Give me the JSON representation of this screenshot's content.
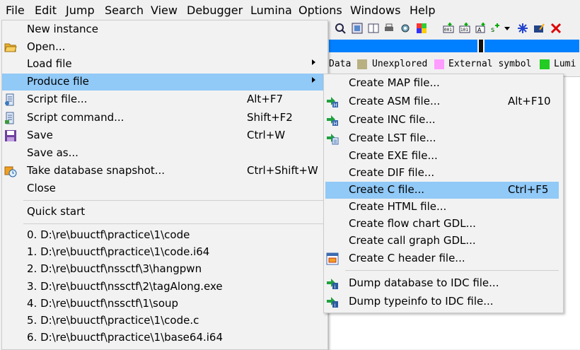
{
  "menubar": [
    "File",
    "Edit",
    "Jump",
    "Search",
    "View",
    "Debugger",
    "Lumina",
    "Options",
    "Windows",
    "Help"
  ],
  "legend": {
    "data": "Data",
    "unexplored": "Unexplored",
    "external": "External symbol",
    "lumina": "Lumi"
  },
  "colors": {
    "highlight": "#91c9f7",
    "nav_blue": "#0080ff",
    "unexplored": "#b8b080",
    "external": "#ff9cff",
    "lumina": "#22cc22"
  },
  "file_menu": {
    "new_instance": "New instance",
    "open": "Open...",
    "load_file": "Load file",
    "produce_file": "Produce file",
    "script_file": "Script file...",
    "script_file_sc": "Alt+F7",
    "script_command": "Script command...",
    "script_command_sc": "Shift+F2",
    "save": "Save",
    "save_sc": "Ctrl+W",
    "save_as": "Save as...",
    "snapshot": "Take database snapshot...",
    "snapshot_sc": "Ctrl+Shift+W",
    "close": "Close",
    "quick_start": "Quick start",
    "recent": [
      "0. D:\\re\\buuctf\\practice\\1\\code",
      "1. D:\\re\\buuctf\\practice\\1\\code.i64",
      "2. D:\\re\\buuctf\\nssctf\\3\\hangpwn",
      "3. D:\\re\\buuctf\\nssctf\\2\\tagAlong.exe",
      "4. D:\\re\\buuctf\\nssctf\\1\\soup",
      "5. D:\\re\\buuctf\\practice\\1\\code.c",
      "6. D:\\re\\buuctf\\practice\\1\\base64.i64"
    ]
  },
  "produce_menu": {
    "map": "Create MAP file...",
    "asm": "Create ASM file...",
    "asm_sc": "Alt+F10",
    "inc": "Create INC file...",
    "lst": "Create LST file...",
    "exe": "Create EXE file...",
    "dif": "Create DIF file...",
    "c": "Create C file...",
    "c_sc": "Ctrl+F5",
    "html": "Create HTML file...",
    "flow": "Create flow chart GDL...",
    "call": "Create call graph GDL...",
    "header": "Create C header file...",
    "idc_db": "Dump database to IDC file...",
    "idc_type": "Dump typeinfo to IDC file..."
  }
}
